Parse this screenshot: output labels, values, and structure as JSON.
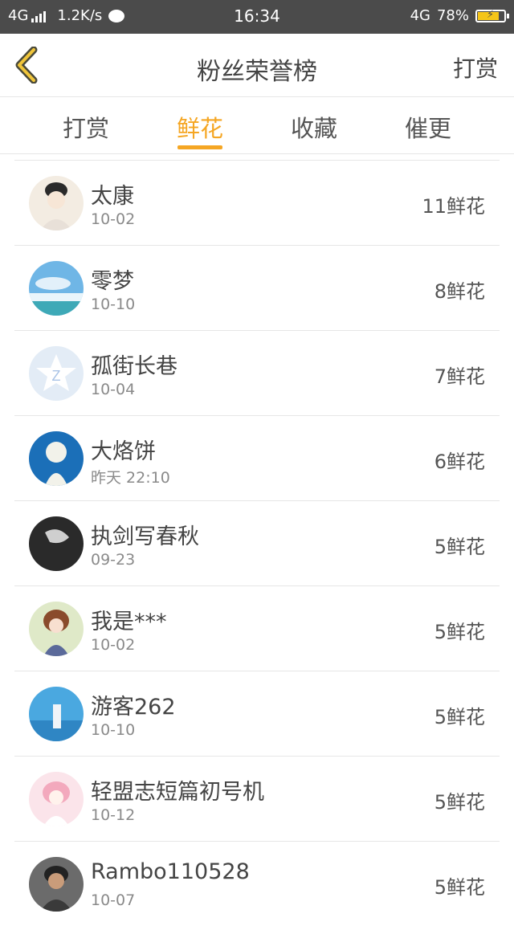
{
  "status_bar": {
    "network_left": "4G",
    "speed": "1.2K/s",
    "time": "16:34",
    "network_right": "4G",
    "battery": "78%"
  },
  "header": {
    "title": "粉丝荣誉榜",
    "action": "打赏",
    "back_icon": "chevron-left-icon"
  },
  "tabs": [
    {
      "label": "打赏",
      "active": false
    },
    {
      "label": "鲜花",
      "active": true
    },
    {
      "label": "收藏",
      "active": false
    },
    {
      "label": "催更",
      "active": false
    }
  ],
  "accent_color": "#f5a623",
  "fans": [
    {
      "name": "太康",
      "date": "10-02",
      "count": "11鲜花"
    },
    {
      "name": "零梦",
      "date": "10-10",
      "count": "8鲜花"
    },
    {
      "name": "孤街长巷",
      "date": "10-04",
      "count": "7鲜花"
    },
    {
      "name": "大烙饼",
      "date": "昨天 22:10",
      "count": "6鲜花"
    },
    {
      "name": "执剑写春秋",
      "date": "09-23",
      "count": "5鲜花"
    },
    {
      "name": "我是***",
      "date": "10-02",
      "count": "5鲜花"
    },
    {
      "name": "游客262",
      "date": "10-10",
      "count": "5鲜花"
    },
    {
      "name": "轻盟志短篇初号机",
      "date": "10-12",
      "count": "5鲜花"
    },
    {
      "name": "Rambo110528",
      "date": "10-07",
      "count": "5鲜花"
    }
  ]
}
